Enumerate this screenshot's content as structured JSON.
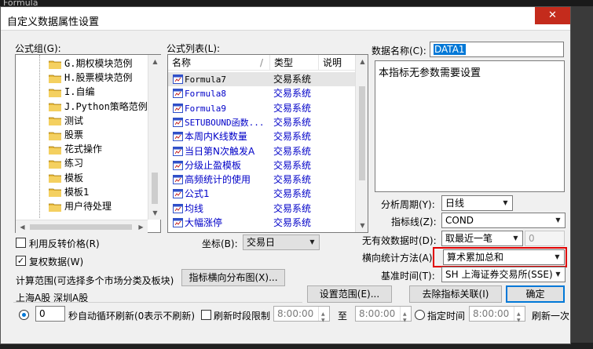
{
  "background": {
    "title_fragment": "Formula"
  },
  "dialog": {
    "title": "自定义数据属性设置",
    "close_glyph": "✕"
  },
  "group": {
    "label": "公式组(G):",
    "items": [
      {
        "label": "G.期权模块范例",
        "style": "mono"
      },
      {
        "label": "H.股票模块范例",
        "style": "mono"
      },
      {
        "label": "I.自编",
        "style": "mono"
      },
      {
        "label": "J.Python策略范例",
        "style": "mono"
      },
      {
        "label": "测试",
        "style": "normal"
      },
      {
        "label": "股票",
        "style": "normal"
      },
      {
        "label": "花式操作",
        "style": "normal"
      },
      {
        "label": "练习",
        "style": "normal"
      },
      {
        "label": "模板",
        "style": "normal"
      },
      {
        "label": "模板1",
        "style": "normal"
      },
      {
        "label": "用户待处理",
        "style": "normal"
      }
    ]
  },
  "formulas": {
    "label": "公式列表(L):",
    "col_name": "名称",
    "col_type": "类型",
    "col_desc": "说明",
    "rows": [
      {
        "name": "Formula7",
        "type": "交易系统",
        "selected": true
      },
      {
        "name": "Formula8",
        "type": "交易系统",
        "selected": false
      },
      {
        "name": "Formula9",
        "type": "交易系统",
        "selected": false
      },
      {
        "name": "SETUBOUND函数...",
        "type": "交易系统",
        "selected": false
      },
      {
        "name": "本周内K线数量",
        "type": "交易系统",
        "selected": false
      },
      {
        "name": "当日第N次触发A",
        "type": "交易系统",
        "selected": false
      },
      {
        "name": "分级止盈模板",
        "type": "交易系统",
        "selected": false
      },
      {
        "name": "高频统计的使用",
        "type": "交易系统",
        "selected": false
      },
      {
        "name": "公式1",
        "type": "交易系统",
        "selected": false
      },
      {
        "name": "均线",
        "type": "交易系统",
        "selected": false
      },
      {
        "name": "大幅涨停",
        "type": "交易系统",
        "selected": false
      }
    ]
  },
  "data_name": {
    "label": "数据名称(C):",
    "value": "DATA1"
  },
  "description": "本指标无参数需要设置",
  "period": {
    "label": "分析周期(Y):",
    "value": "日线"
  },
  "indicator_line": {
    "label": "指标线(Z):",
    "value": "COND"
  },
  "invalid_data": {
    "label": "无有效数据时(D):",
    "value": "取最近一笔",
    "number": "0"
  },
  "horizontal_method": {
    "label": "横向统计方法(A)",
    "value": "算术累加总和"
  },
  "base_time": {
    "label": "基准时间(T):",
    "value": "SH 上海证券交易所(SSE)"
  },
  "coordinate": {
    "label": "坐标(B):",
    "value": "交易日"
  },
  "reverse_price": {
    "label": "利用反转价格(R)",
    "checked": false
  },
  "adjusted_data": {
    "label": "复权数据(W)",
    "checked": true
  },
  "calc_range": {
    "label": "计算范围(可选择多个市场分类及板块)",
    "distribution_button": "指标横向分布图(X)...",
    "value": "上海A股  深圳A股",
    "set_button": "设置范围(E)...",
    "remove_button": "去除指标关联(I)",
    "ok_button": "确定"
  },
  "refresh": {
    "seconds": "0",
    "seconds_label": "秒自动循环刷新(0表示不刷新)",
    "period_limit_label": "刷新时段限制",
    "time_from": "8:00:00",
    "to_label": "至",
    "time_to": "8:00:00",
    "specified_label": "指定时间",
    "time_specified": "8:00:00",
    "refresh_once_label": "刷新一次"
  }
}
